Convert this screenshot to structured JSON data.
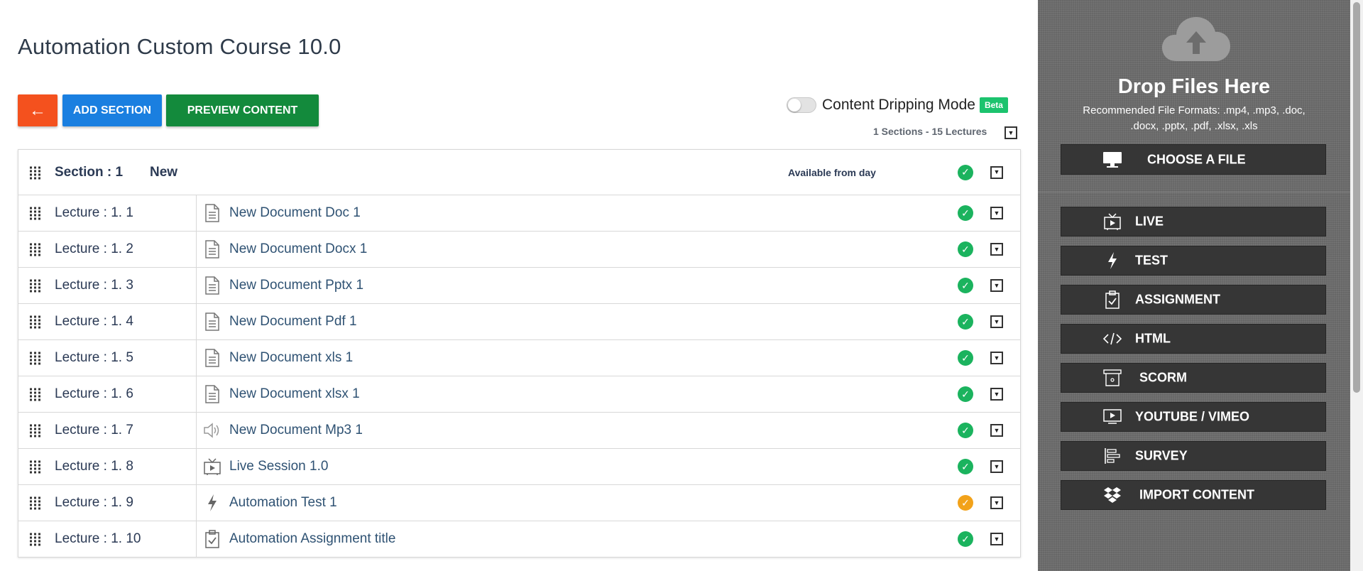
{
  "course": {
    "title": "Automation Custom Course 10.0"
  },
  "toolbar": {
    "back_label": "←",
    "add_section_label": "ADD SECTION",
    "preview_label": "PREVIEW CONTENT"
  },
  "drip": {
    "label": "Content Dripping Mode",
    "badge": "Beta",
    "enabled": false
  },
  "summary": "1 Sections - 15 Lectures",
  "section": {
    "name": "Section : 1",
    "title": "New",
    "availability": "Available from day",
    "status": "complete"
  },
  "lectures": [
    {
      "number": "Lecture : 1. 1",
      "title": "New Document Doc 1",
      "icon": "document-icon",
      "status": "complete"
    },
    {
      "number": "Lecture : 1. 2",
      "title": "New Document Docx 1",
      "icon": "document-icon",
      "status": "complete"
    },
    {
      "number": "Lecture : 1. 3",
      "title": "New Document Pptx 1",
      "icon": "document-icon",
      "status": "complete"
    },
    {
      "number": "Lecture : 1. 4",
      "title": "New Document Pdf 1",
      "icon": "document-icon",
      "status": "complete"
    },
    {
      "number": "Lecture : 1. 5",
      "title": "New Document xls 1",
      "icon": "document-icon",
      "status": "complete"
    },
    {
      "number": "Lecture : 1. 6",
      "title": "New Document xlsx 1",
      "icon": "document-icon",
      "status": "complete"
    },
    {
      "number": "Lecture : 1. 7",
      "title": "New Document Mp3 1",
      "icon": "audio-icon",
      "status": "complete"
    },
    {
      "number": "Lecture : 1. 8",
      "title": "Live Session 1.0",
      "icon": "live-tv-icon",
      "status": "complete"
    },
    {
      "number": "Lecture : 1. 9",
      "title": "Automation Test 1",
      "icon": "bolt-icon",
      "status": "pending"
    },
    {
      "number": "Lecture : 1. 10",
      "title": "Automation Assignment title",
      "icon": "clipboard-check-icon",
      "status": "complete"
    }
  ],
  "sidebar": {
    "drop_title": "Drop Files Here",
    "drop_formats": "Recommended File Formats: .mp4, .mp3, .doc, .docx, .pptx, .pdf, .xlsx, .xls",
    "choose_label": "CHOOSE A FILE",
    "buttons": [
      {
        "label": "LIVE",
        "icon": "live-tv-icon"
      },
      {
        "label": "TEST",
        "icon": "bolt-icon"
      },
      {
        "label": "ASSIGNMENT",
        "icon": "clipboard-check-icon"
      },
      {
        "label": "HTML",
        "icon": "code-icon"
      },
      {
        "label": "SCORM",
        "icon": "scorm-icon"
      },
      {
        "label": "YOUTUBE / VIMEO",
        "icon": "video-play-icon"
      },
      {
        "label": "SURVEY",
        "icon": "survey-bars-icon"
      },
      {
        "label": "IMPORT CONTENT",
        "icon": "dropbox-icon"
      }
    ]
  },
  "colors": {
    "back_button": "#f4511e",
    "add_section_button": "#1a7fe0",
    "preview_button": "#138a3c",
    "status_complete": "#1bb35e",
    "status_pending": "#f2a21a",
    "sidebar_bg": "#6d6d6d",
    "sidebar_button": "#363636",
    "beta_badge": "#1cc36e"
  }
}
